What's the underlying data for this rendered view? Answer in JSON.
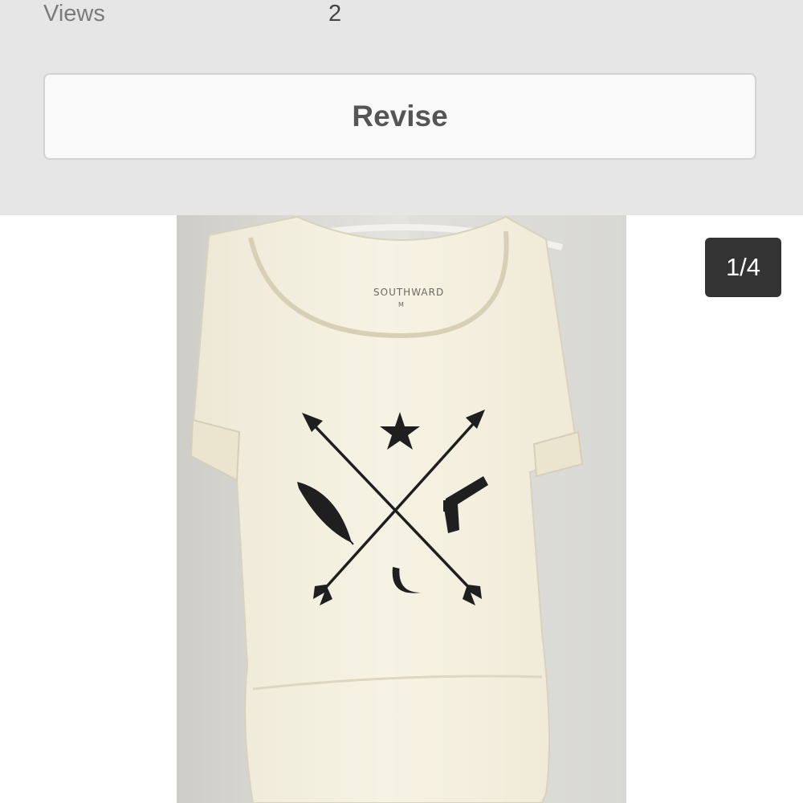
{
  "stats": {
    "views_label": "Views",
    "views_value": "2"
  },
  "actions": {
    "revise_label": "Revise"
  },
  "gallery": {
    "counter": "1/4",
    "current_index": 1,
    "total": 4,
    "image_icon": "tshirt-photo",
    "shirt_brand": "SOUTHWARD"
  },
  "colors": {
    "panel_bg": "#e6e6e6",
    "button_bg": "#f9f9f9",
    "counter_bg": "#333333"
  }
}
